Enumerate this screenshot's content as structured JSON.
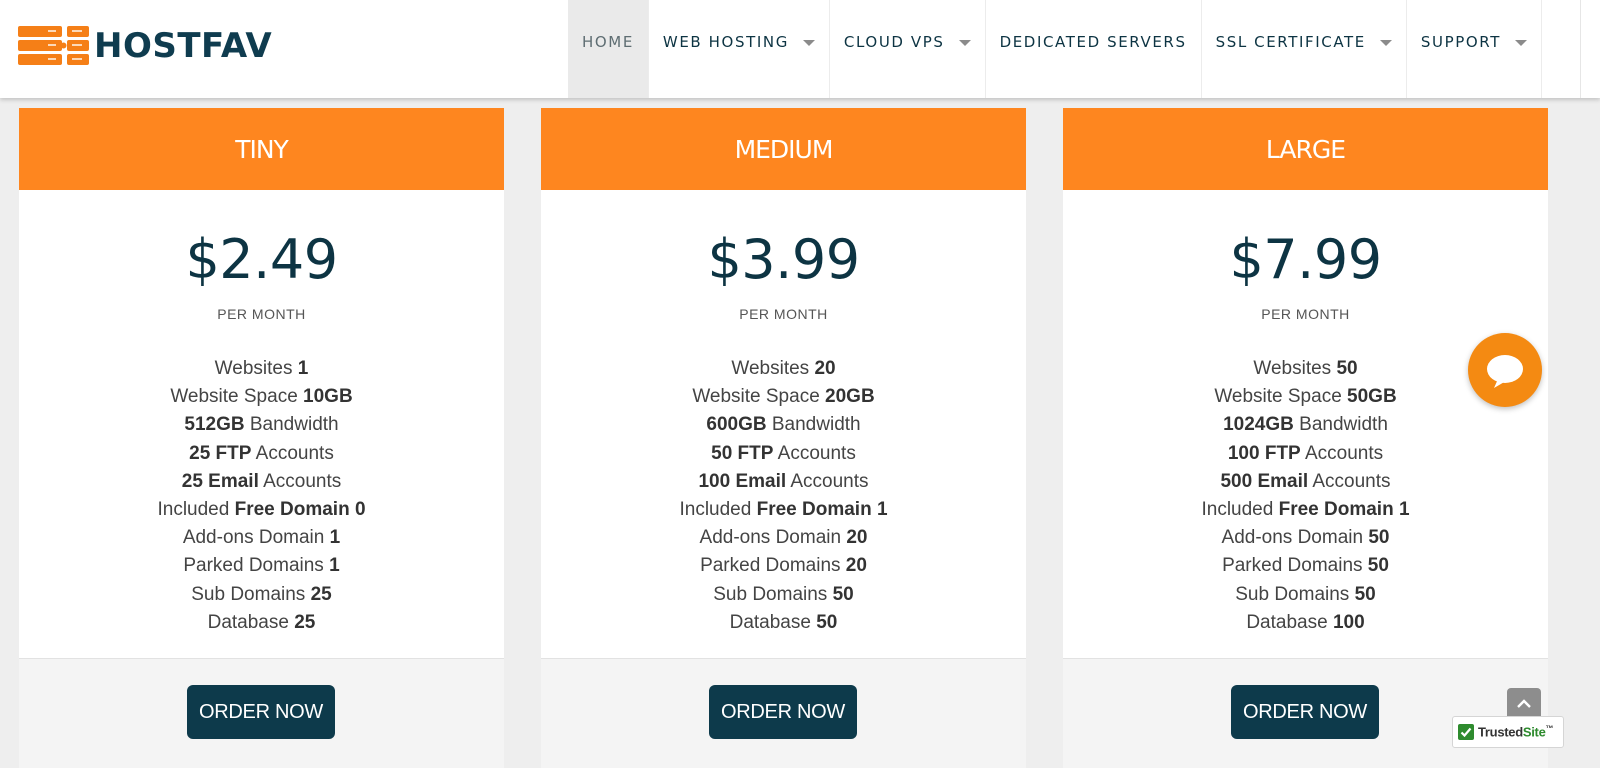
{
  "brand": {
    "name": "HOSTFAV",
    "accent_color": "#fe861f",
    "dark_color": "#0d3443"
  },
  "nav": {
    "items": [
      {
        "label": "HOME",
        "has_dropdown": false,
        "active": true
      },
      {
        "label": "WEB HOSTING",
        "has_dropdown": true,
        "active": false
      },
      {
        "label": "CLOUD VPS",
        "has_dropdown": true,
        "active": false
      },
      {
        "label": "DEDICATED SERVERS",
        "has_dropdown": false,
        "active": false
      },
      {
        "label": "SSL CERTIFICATE",
        "has_dropdown": true,
        "active": false
      },
      {
        "label": "SUPPORT",
        "has_dropdown": true,
        "active": false
      }
    ]
  },
  "plans": [
    {
      "name": "TINY",
      "price": "$2.49",
      "period": "PER MONTH",
      "features": [
        {
          "pre": "Websites ",
          "bold": "1",
          "post": ""
        },
        {
          "pre": "Website Space ",
          "bold": "10GB",
          "post": ""
        },
        {
          "pre": "",
          "bold": "512GB",
          "post": " Bandwidth"
        },
        {
          "pre": "",
          "bold": "25 FTP",
          "post": " Accounts"
        },
        {
          "pre": "",
          "bold": "25 Email",
          "post": " Accounts"
        },
        {
          "pre": "Included ",
          "bold": "Free Domain 0",
          "post": ""
        },
        {
          "pre": "Add-ons Domain ",
          "bold": "1",
          "post": ""
        },
        {
          "pre": "Parked Domains ",
          "bold": "1",
          "post": ""
        },
        {
          "pre": "Sub Domains ",
          "bold": "25",
          "post": ""
        },
        {
          "pre": "Database ",
          "bold": "25",
          "post": ""
        }
      ],
      "button": "ORDER NOW"
    },
    {
      "name": "MEDIUM",
      "price": "$3.99",
      "period": "PER MONTH",
      "features": [
        {
          "pre": "Websites ",
          "bold": "20",
          "post": ""
        },
        {
          "pre": "Website Space ",
          "bold": "20GB",
          "post": ""
        },
        {
          "pre": "",
          "bold": "600GB",
          "post": " Bandwidth"
        },
        {
          "pre": "",
          "bold": "50 FTP",
          "post": " Accounts"
        },
        {
          "pre": "",
          "bold": "100 Email",
          "post": " Accounts"
        },
        {
          "pre": "Included ",
          "bold": "Free Domain 1",
          "post": ""
        },
        {
          "pre": "Add-ons Domain ",
          "bold": "20",
          "post": ""
        },
        {
          "pre": "Parked Domains ",
          "bold": "20",
          "post": ""
        },
        {
          "pre": "Sub Domains ",
          "bold": "50",
          "post": ""
        },
        {
          "pre": "Database ",
          "bold": "50",
          "post": ""
        }
      ],
      "button": "ORDER NOW"
    },
    {
      "name": "LARGE",
      "price": "$7.99",
      "period": "PER MONTH",
      "features": [
        {
          "pre": "Websites ",
          "bold": "50",
          "post": ""
        },
        {
          "pre": "Website Space ",
          "bold": "50GB",
          "post": ""
        },
        {
          "pre": "",
          "bold": "1024GB",
          "post": " Bandwidth"
        },
        {
          "pre": "",
          "bold": "100 FTP",
          "post": " Accounts"
        },
        {
          "pre": "",
          "bold": "500 Email",
          "post": " Accounts"
        },
        {
          "pre": "Included ",
          "bold": "Free Domain 1",
          "post": ""
        },
        {
          "pre": "Add-ons Domain ",
          "bold": "50",
          "post": ""
        },
        {
          "pre": "Parked Domains ",
          "bold": "50",
          "post": ""
        },
        {
          "pre": "Sub Domains ",
          "bold": "50",
          "post": ""
        },
        {
          "pre": "Database ",
          "bold": "100",
          "post": ""
        }
      ],
      "button": "ORDER NOW"
    }
  ],
  "widgets": {
    "chat_icon": "chat-bubble-icon",
    "scroll_top_icon": "chevron-up-icon",
    "trusted_badge": {
      "prefix": "Trusted",
      "suffix": "Site",
      "superscript": "™"
    }
  }
}
